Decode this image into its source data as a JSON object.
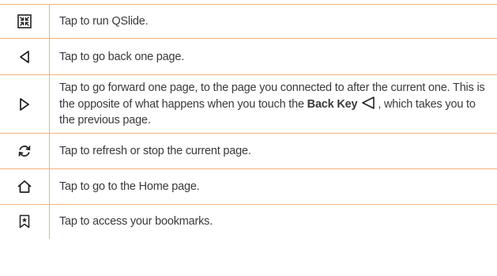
{
  "rows": [
    {
      "icon": "qslide-icon",
      "text": "Tap to run QSlide."
    },
    {
      "icon": "back-triangle-icon",
      "text": "Tap to go back one page."
    },
    {
      "icon": "forward-triangle-icon",
      "text_before": "Tap to go forward one page, to the page you connected to after the current one. This is the opposite of what happens when you touch the ",
      "bold": "Back Key",
      "text_after": ", which takes you to the previous page."
    },
    {
      "icon": "refresh-icon",
      "text": "Tap to refresh or stop the current page."
    },
    {
      "icon": "home-icon",
      "text": "Tap to go to the Home page."
    },
    {
      "icon": "bookmark-icon",
      "text": "Tap to access your bookmarks."
    }
  ],
  "colors": {
    "rule": "#f2b27a",
    "text": "#3a3a3a",
    "icon": "#222222"
  }
}
